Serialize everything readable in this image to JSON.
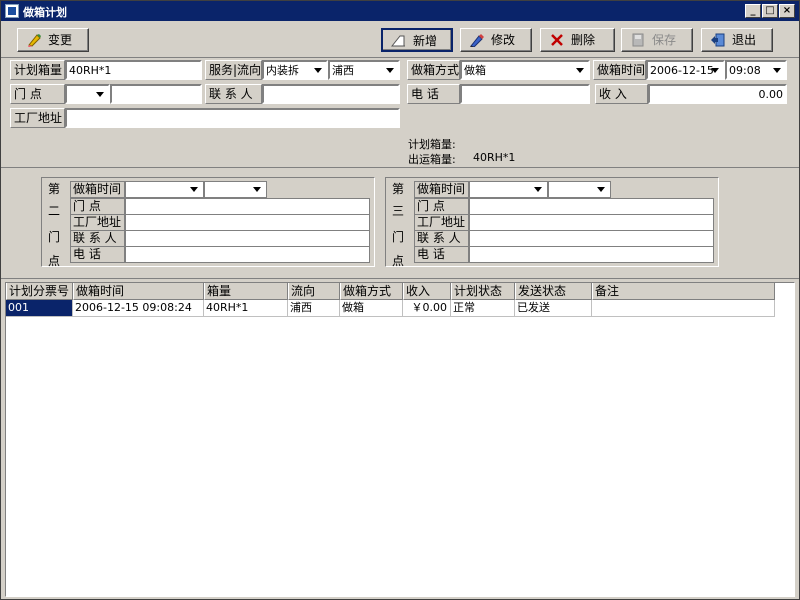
{
  "window": {
    "title": "做箱计划",
    "controls": {
      "minimize": "_",
      "maximize": "□",
      "close": "×"
    }
  },
  "toolbar": {
    "change": "变更",
    "add": "新增",
    "modify": "修改",
    "delete": "删除",
    "save": "保存",
    "exit": "退出"
  },
  "form": {
    "plan_box_qty": {
      "label": "计划箱量",
      "value": "40RH*1"
    },
    "service_flow": {
      "label": "服务|流向",
      "service_value": "内装拆",
      "flow_value": "浦西"
    },
    "boxing_method": {
      "label": "做箱方式",
      "value": "做箱"
    },
    "boxing_time": {
      "label": "做箱时间",
      "date": "2006-12-15",
      "time": "09:08"
    },
    "door_point": {
      "label": "门    点",
      "value": "",
      "detail": ""
    },
    "contact": {
      "label": "联 系 人",
      "value": ""
    },
    "phone": {
      "label": "电    话",
      "value": ""
    },
    "income": {
      "label": "收    入",
      "value": "0.00"
    },
    "factory_address": {
      "label": "工厂地址",
      "value": ""
    },
    "summary": {
      "plan_label": "计划箱量:",
      "plan_value": "",
      "ship_label": "出运箱量:",
      "ship_value": "40RH*1"
    }
  },
  "door2": {
    "vlabel": [
      "第",
      "二",
      "门",
      "点"
    ],
    "time_label": "做箱时间",
    "door_label": "门    点",
    "factory_label": "工厂地址",
    "contact_label": "联 系 人",
    "phone_label": "电    话"
  },
  "door3": {
    "vlabel": [
      "第",
      "三",
      "门",
      "点"
    ],
    "time_label": "做箱时间",
    "door_label": "门    点",
    "factory_label": "工厂地址",
    "contact_label": "联 系 人",
    "phone_label": "电    话"
  },
  "grid": {
    "headers": [
      "计划分票号",
      "做箱时间",
      "箱量",
      "流向",
      "做箱方式",
      "收入",
      "计划状态",
      "发送状态",
      "备注"
    ],
    "rows": [
      [
        "001",
        "2006-12-15 09:08:24",
        "40RH*1",
        "浦西",
        "做箱",
        "￥0.00",
        "正常",
        "已发送",
        ""
      ]
    ]
  },
  "colors": {
    "titlebar": "#0a246a",
    "face": "#d4d0c8",
    "selection": "#0a246a"
  }
}
